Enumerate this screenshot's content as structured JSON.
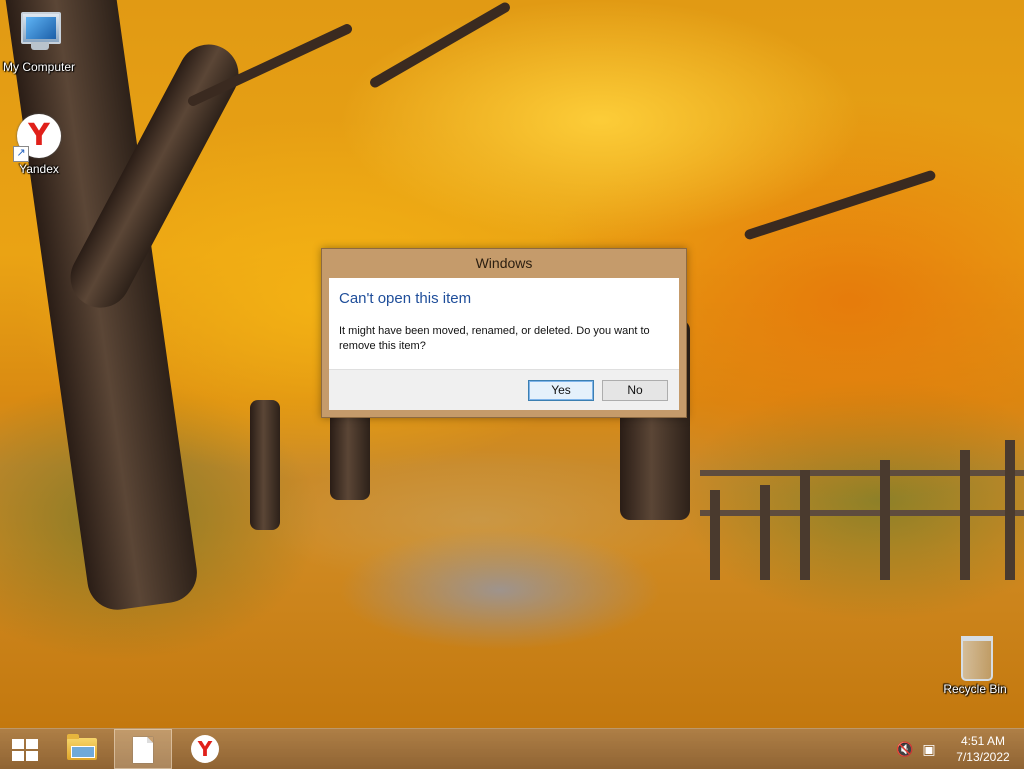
{
  "desktop": {
    "icons": [
      {
        "label": "My Computer",
        "icon": "computer-icon"
      },
      {
        "label": "Yandex",
        "icon": "yandex-icon"
      },
      {
        "label": "Recycle Bin",
        "icon": "recycle-bin-icon"
      }
    ]
  },
  "dialog": {
    "title": "Windows",
    "heading": "Can't open this item",
    "message": "It might have been moved, renamed, or deleted. Do you want to remove this item?",
    "buttons": {
      "yes": "Yes",
      "no": "No"
    },
    "default_button": "yes"
  },
  "taskbar": {
    "items": [
      {
        "icon": "windows-start-icon"
      },
      {
        "icon": "file-explorer-icon"
      },
      {
        "icon": "document-icon",
        "active": true
      },
      {
        "icon": "yandex-browser-icon"
      }
    ],
    "tray": {
      "icons": [
        "volume-muted-icon",
        "network-icon"
      ]
    },
    "clock": {
      "time": "4:51 AM",
      "date": "7/13/2022"
    }
  },
  "colors": {
    "dialog_frame": "#c59b6b",
    "heading_blue": "#1f4e9a",
    "taskbar": "#aa783c"
  }
}
